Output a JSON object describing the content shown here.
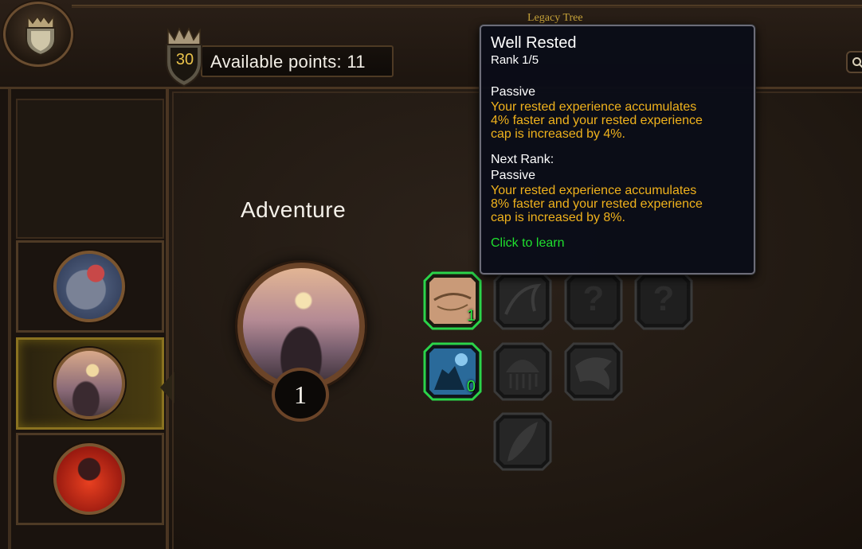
{
  "header": {
    "tree_title": "Legacy Tree",
    "level": "30",
    "available_points_text": "Available points: 11"
  },
  "icons": {
    "crest": "shield-crown-icon",
    "level_badge": "crown-shield-icon",
    "search": "search-icon"
  },
  "sidebar": {
    "categories": [
      {
        "name": "category-armored-train",
        "active": false
      },
      {
        "name": "category-adventure",
        "active": true
      },
      {
        "name": "category-fire-dragon",
        "active": false
      }
    ]
  },
  "tree": {
    "name": "Adventure",
    "rank": "1"
  },
  "nodes": [
    {
      "id": "well-rested",
      "rank": "1",
      "state": "learned"
    },
    {
      "id": "mount",
      "state": "locked"
    },
    {
      "id": "unknown-1",
      "label": "?",
      "state": "unknown"
    },
    {
      "id": "unknown-2",
      "label": "?",
      "state": "unknown"
    },
    {
      "id": "night-travel",
      "rank": "0",
      "state": "available"
    },
    {
      "id": "jellyfish",
      "state": "locked"
    },
    {
      "id": "eagle",
      "state": "locked"
    },
    {
      "id": "feather",
      "state": "locked"
    }
  ],
  "tooltip": {
    "title": "Well Rested",
    "rank": "Rank 1/5",
    "current_type": "Passive",
    "current_desc": [
      "Your rested experience accumulates",
      "4% faster and your rested experience",
      "cap is increased by 4%."
    ],
    "next_label": "Next Rank:",
    "next_type": "Passive",
    "next_desc": [
      "Your rested experience accumulates",
      "8% faster and your rested experience",
      "cap is increased by 8%."
    ],
    "action": "Click to learn"
  },
  "colors": {
    "accent_gold": "#e9c24a",
    "tooltip_desc": "#f0b21c",
    "learn_green": "#1fe02e",
    "node_active_border": "#2bd44a"
  }
}
